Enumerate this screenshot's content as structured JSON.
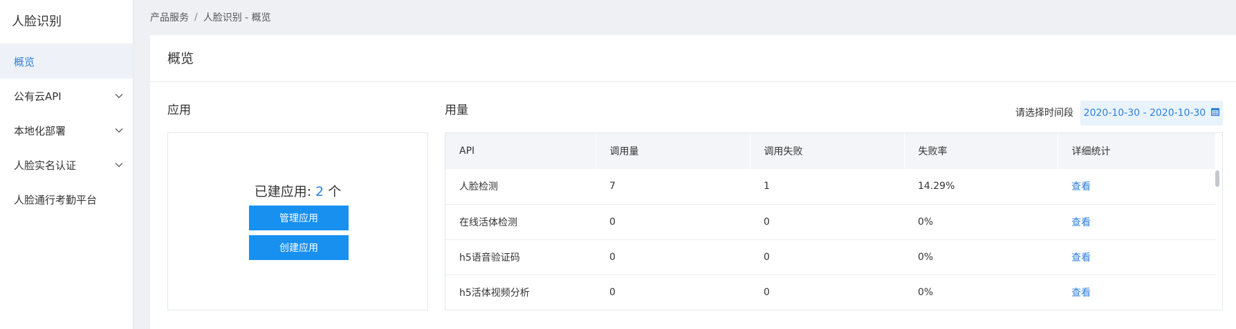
{
  "sidebar": {
    "title": "人脸识别",
    "items": [
      {
        "label": "概览",
        "active": true,
        "expandable": false
      },
      {
        "label": "公有云API",
        "active": false,
        "expandable": true
      },
      {
        "label": "本地化部署",
        "active": false,
        "expandable": true
      },
      {
        "label": "人脸实名认证",
        "active": false,
        "expandable": true
      },
      {
        "label": "人脸通行考勤平台",
        "active": false,
        "expandable": false
      }
    ]
  },
  "breadcrumb": {
    "root": "产品服务",
    "separator": "/",
    "current": "人脸识别 - 概览"
  },
  "page": {
    "title": "概览"
  },
  "apps": {
    "label": "应用",
    "count_prefix": "已建应用:",
    "count": "2",
    "count_suffix": "个",
    "manage_label": "管理应用",
    "create_label": "创建应用"
  },
  "usage": {
    "label": "用量",
    "date_label": "请选择时间段",
    "date_range": "2020-10-30 - 2020-10-30",
    "columns": [
      "API",
      "调用量",
      "调用失败",
      "失败率",
      "详细统计"
    ],
    "rows": [
      {
        "api": "人脸检测",
        "calls": "7",
        "failures": "1",
        "rate": "14.29%",
        "detail": "查看"
      },
      {
        "api": "在线活体检测",
        "calls": "0",
        "failures": "0",
        "rate": "0%",
        "detail": "查看"
      },
      {
        "api": "h5语音验证码",
        "calls": "0",
        "failures": "0",
        "rate": "0%",
        "detail": "查看"
      },
      {
        "api": "h5活体视频分析",
        "calls": "0",
        "failures": "0",
        "rate": "0%",
        "detail": "查看"
      }
    ]
  },
  "colors": {
    "accent": "#2b7fe0",
    "button": "#1890f0",
    "active_bg": "#eef2f8",
    "page_bg": "#eef0f4"
  },
  "icons": {
    "expand": "chevron-down-icon",
    "calendar": "calendar-icon"
  }
}
